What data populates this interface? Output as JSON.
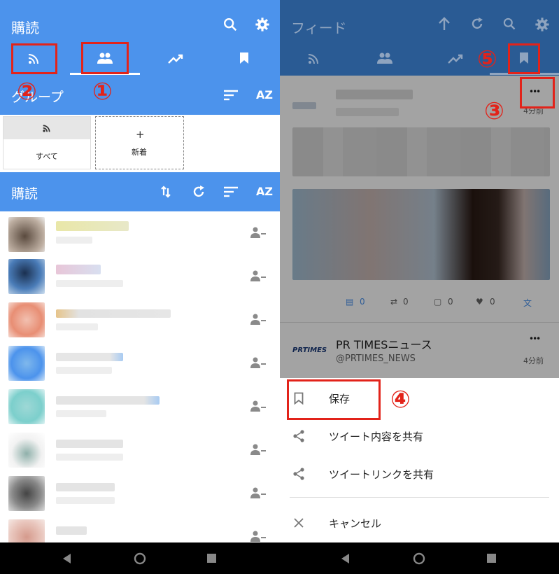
{
  "left": {
    "header_title": "購読",
    "group_title": "グループ",
    "subscription_title": "購読",
    "groups": [
      {
        "label": "すべて"
      },
      {
        "label": "新着",
        "icon_text": "+"
      }
    ],
    "sort_az_label": "AZ",
    "annotations": {
      "one": "①",
      "two": "②"
    }
  },
  "right": {
    "header_title": "フィード",
    "annotations": {
      "three": "③",
      "four": "④",
      "five": "⑤"
    },
    "post1": {
      "time": "4分前",
      "more": "•••",
      "stats": {
        "reply": "0",
        "retweet": "0",
        "quote": "0",
        "like": "0"
      }
    },
    "post2": {
      "logo_text": "PRTIMES",
      "name": "PR TIMESニュース",
      "handle": "@PRTIMES_NEWS",
      "time": "4分前",
      "more": "•••"
    },
    "sheet": {
      "save": "保存",
      "share_content": "ツイート内容を共有",
      "share_link": "ツイートリンクを共有",
      "cancel": "キャンセル"
    }
  },
  "colors": {
    "primary": "#4c93ec",
    "annotation_red": "#e2231a",
    "right_header": "#2a5b94"
  }
}
